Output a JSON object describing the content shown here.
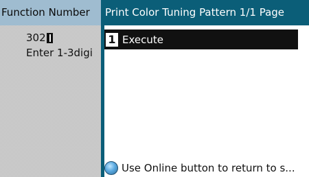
{
  "left": {
    "title": "Function Number",
    "value": "302",
    "hint": "Enter 1-3digi"
  },
  "right": {
    "title": "Print Color Tuning Pattern 1/1 Page",
    "menu": [
      {
        "number": "1",
        "label": "Execute",
        "selected": true
      }
    ],
    "status": "Use Online button to return to s..."
  },
  "colors": {
    "title_bar": "#0b5e78",
    "left_title_bg": "#9fbcd0",
    "selected_bg": "#111111",
    "online_icon": "#5aa9e0"
  },
  "icons": {
    "cursor": "text-cursor-icon",
    "online": "online-button-icon"
  }
}
